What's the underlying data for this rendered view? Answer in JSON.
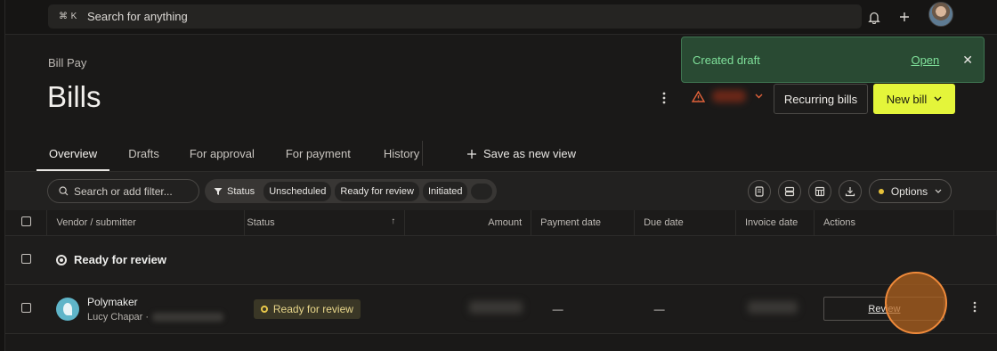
{
  "topbar": {
    "kbd_cmd": "⌘",
    "kbd_key": "K",
    "search_placeholder": "Search for anything"
  },
  "page": {
    "breadcrumb": "Bill Pay",
    "title": "Bills"
  },
  "actions": {
    "recurring_label": "Recurring bills",
    "new_bill_label": "New bill",
    "new_bill_color": "#e4f53a",
    "warning_color": "#e2623a"
  },
  "toast": {
    "message": "Created draft",
    "link": "Open",
    "close": "✕"
  },
  "tabs": [
    "Overview",
    "Drafts",
    "For approval",
    "For payment",
    "History"
  ],
  "save_view_label": "Save as new view",
  "filters": {
    "search_placeholder": "Search or add filter...",
    "status_label": "Status",
    "chips": [
      "Unscheduled",
      "Ready for review",
      "Initiated"
    ],
    "options_label": "Options"
  },
  "table": {
    "columns": [
      "Vendor / submitter",
      "Status",
      "Amount",
      "Payment date",
      "Due date",
      "Invoice date",
      "Actions"
    ],
    "sort_indicator": "↑",
    "group_label": "Ready for review",
    "rows": [
      {
        "vendor": "Polymaker",
        "submitter": "Lucy Chapar ·",
        "status": "Ready for review",
        "payment_date": "—",
        "due_date": "—",
        "action": "Review"
      }
    ]
  }
}
